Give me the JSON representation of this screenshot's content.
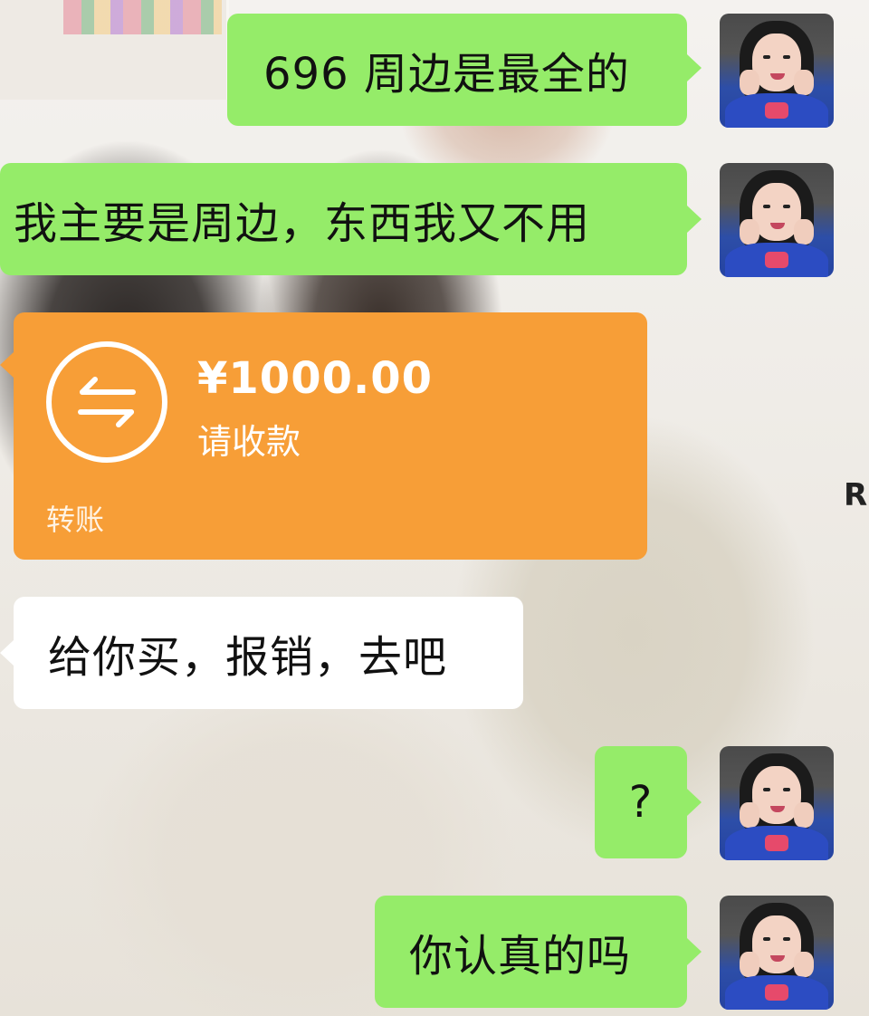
{
  "background": {
    "corner_letter": "R"
  },
  "messages": [
    {
      "side": "right",
      "type": "text",
      "text": "696 周边是最全的"
    },
    {
      "side": "right",
      "type": "text",
      "text": "我主要是周边，东西我又不用"
    },
    {
      "side": "left",
      "type": "transfer",
      "amount": "¥1000.00",
      "status": "请收款",
      "label": "转账"
    },
    {
      "side": "left",
      "type": "text",
      "text": "给你买，报销，去吧"
    },
    {
      "side": "right",
      "type": "text",
      "text": "?"
    },
    {
      "side": "right",
      "type": "text",
      "text": "你认真的吗"
    }
  ],
  "colors": {
    "sent_bubble": "#95ec69",
    "received_bubble": "#ffffff",
    "transfer_card": "#f79e37"
  },
  "icons": {
    "transfer": "transfer-arrows-icon",
    "avatar": "user-avatar"
  }
}
